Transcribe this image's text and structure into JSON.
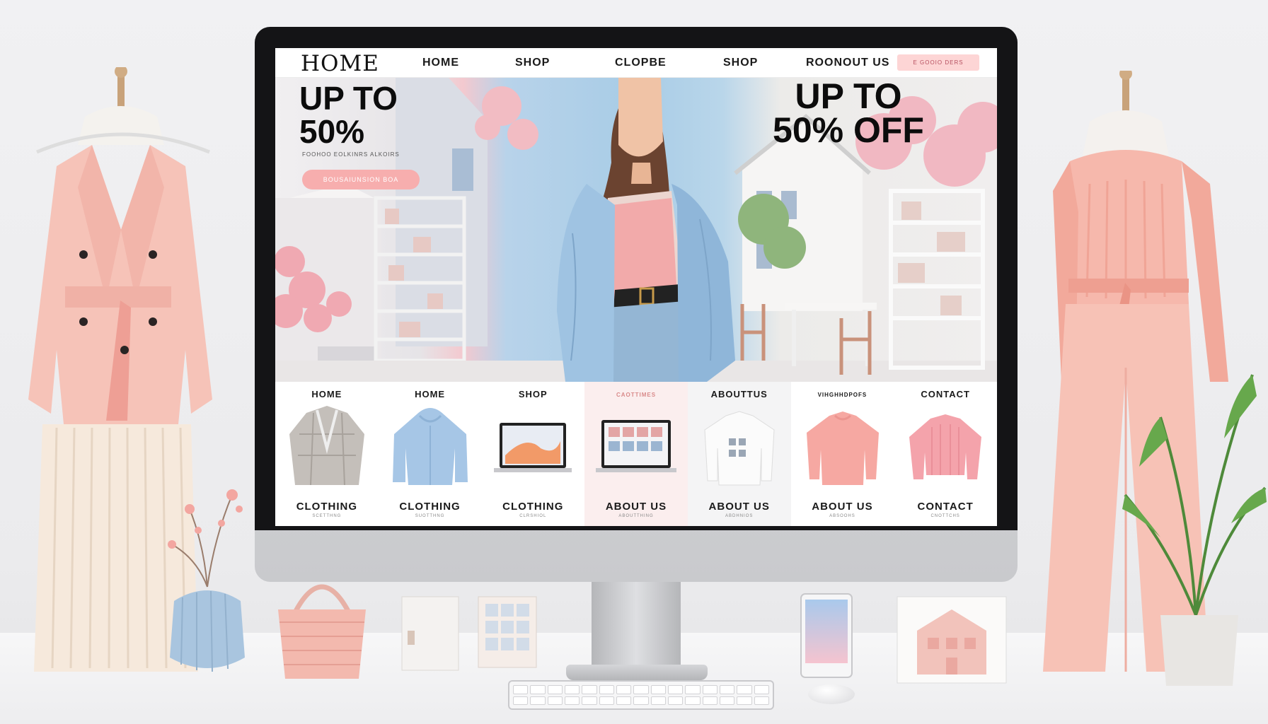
{
  "nav": {
    "logo": "HOME",
    "links": [
      "HOME",
      "SHOP",
      "CLOPBE",
      "SHOP",
      "ROONOUT US"
    ],
    "cta": "E GOOIO DERS"
  },
  "hero": {
    "left_headline_line1": "UP TO",
    "left_headline_line2": "50%",
    "left_subtext": "FOOHOO EOLKINRS ALKOIRS",
    "left_button": "BOUSAIUNSION BOA",
    "right_headline_line1": "UP TO",
    "right_headline_line2": "50% OFF"
  },
  "categories": [
    {
      "top": "HOME",
      "label": "CLOTHING",
      "sub": "SCETTHNG",
      "art": "plaid-blazer"
    },
    {
      "top": "HOME",
      "label": "CLOTHING",
      "sub": "SUOTTHNG",
      "art": "blue-hoodie"
    },
    {
      "top": "SHOP",
      "label": "CLOTHING",
      "sub": "CLRSHIOL",
      "art": "laptop-orange"
    },
    {
      "top": "CAOTTIMES",
      "label": "ABOUT US",
      "sub": "ABOUTTHING",
      "art": "laptop-grid"
    },
    {
      "top": "ABOUTTUS",
      "label": "ABOUT US",
      "sub": "ABDHNIOS",
      "art": "white-sweater"
    },
    {
      "top": "VIHGHHDPOFS",
      "label": "ABOUT US",
      "sub": "ABSOOHS",
      "art": "pink-sweatshirt"
    },
    {
      "top": "CONTACT",
      "label": "CONTACT",
      "sub": "CNOTTCHS",
      "art": "pink-knit"
    }
  ],
  "colors": {
    "accent_pink": "#f7aeae",
    "blush": "#f5c4bc",
    "denim": "#8fb6d9",
    "ink": "#0c0c0c"
  }
}
